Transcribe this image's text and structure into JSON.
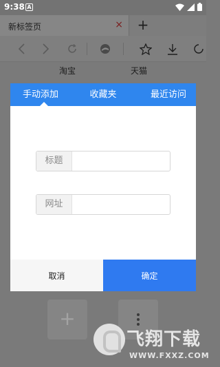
{
  "status_bar": {
    "time": "9:38",
    "notif": "A"
  },
  "tabs": {
    "current_title": "新标签页",
    "close_glyph": "×",
    "new_tab_glyph": "+"
  },
  "quick_links": [
    "淘宝",
    "天猫"
  ],
  "dialog": {
    "tabs": [
      "手动添加",
      "收藏夹",
      "最近访问"
    ],
    "active_tab_index": 0,
    "title_label": "标题",
    "title_value": "",
    "url_label": "网址",
    "url_value": "",
    "cancel_label": "取消",
    "ok_label": "确定",
    "accent_color": "#2f86ee",
    "ok_color": "#2f7af0"
  },
  "bottom": {
    "add_glyph": "+"
  },
  "watermark": {
    "name": "飞翔下载",
    "url": "WWW.FXXZ.COM"
  }
}
